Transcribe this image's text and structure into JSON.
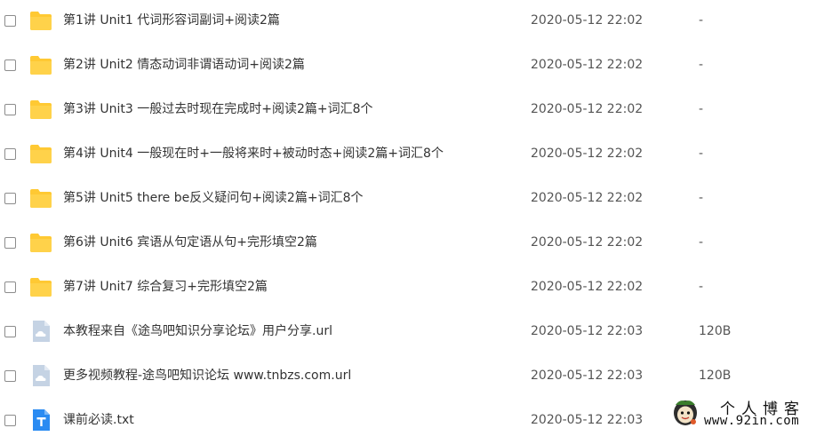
{
  "files": [
    {
      "name": "第1讲 Unit1 代词形容词副词+阅读2篇",
      "date": "2020-05-12 22:02",
      "size": "-",
      "type": "folder"
    },
    {
      "name": "第2讲 Unit2 情态动词非谓语动词+阅读2篇",
      "date": "2020-05-12 22:02",
      "size": "-",
      "type": "folder"
    },
    {
      "name": "第3讲 Unit3 一般过去时现在完成时+阅读2篇+词汇8个",
      "date": "2020-05-12 22:02",
      "size": "-",
      "type": "folder"
    },
    {
      "name": "第4讲 Unit4 一般现在时+一般将来时+被动时态+阅读2篇+词汇8个",
      "date": "2020-05-12 22:02",
      "size": "-",
      "type": "folder"
    },
    {
      "name": "第5讲 Unit5 there be反义疑问句+阅读2篇+词汇8个",
      "date": "2020-05-12 22:02",
      "size": "-",
      "type": "folder"
    },
    {
      "name": "第6讲 Unit6 宾语从句定语从句+完形填空2篇",
      "date": "2020-05-12 22:02",
      "size": "-",
      "type": "folder"
    },
    {
      "name": "第7讲 Unit7 综合复习+完形填空2篇",
      "date": "2020-05-12 22:02",
      "size": "-",
      "type": "folder"
    },
    {
      "name": "本教程来自《途鸟吧知识分享论坛》用户分享.url",
      "date": "2020-05-12 22:03",
      "size": "120B",
      "type": "url"
    },
    {
      "name": "更多视频教程-途鸟吧知识论坛 www.tnbzs.com.url",
      "date": "2020-05-12 22:03",
      "size": "120B",
      "type": "url"
    },
    {
      "name": "课前必读.txt",
      "date": "2020-05-12 22:03",
      "size": "",
      "type": "txt"
    }
  ],
  "watermark": {
    "title": "个人博客",
    "url": "www.92in.com"
  },
  "colors": {
    "folder": "#FFC933",
    "url_icon": "#C5D3E4",
    "txt_icon": "#2A8BF2"
  }
}
